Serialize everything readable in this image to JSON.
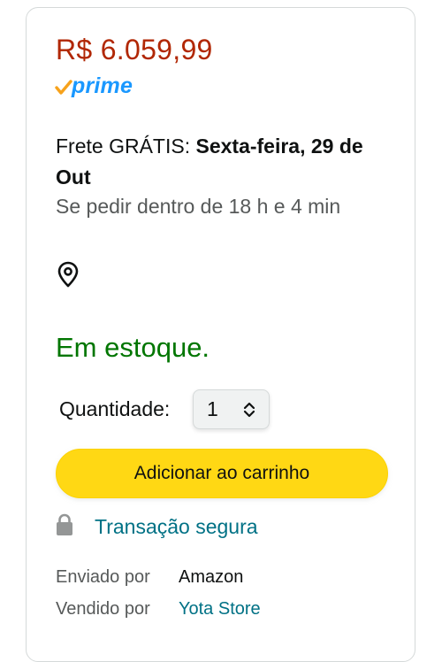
{
  "price": "R$ 6.059,99",
  "prime_label": "prime",
  "delivery": {
    "prefix": "Frete GRÁTIS: ",
    "date": "Sexta-feira, 29 de Out",
    "cutoff": "Se pedir dentro de 18 h e 4 min"
  },
  "location_icon": "location-pin-icon",
  "stock_status": "Em estoque.",
  "quantity": {
    "label": "Quantidade:",
    "value": "1"
  },
  "add_to_cart_label": "Adicionar ao carrinho",
  "secure_transaction": "Transação segura",
  "shipped_by": {
    "label": "Enviado por",
    "value": "Amazon"
  },
  "sold_by": {
    "label": "Vendido por",
    "value": "Yota Store"
  },
  "colors": {
    "price": "#b12704",
    "prime": "#1a98ff",
    "in_stock": "#007600",
    "link": "#007185",
    "button": "#ffd814"
  }
}
